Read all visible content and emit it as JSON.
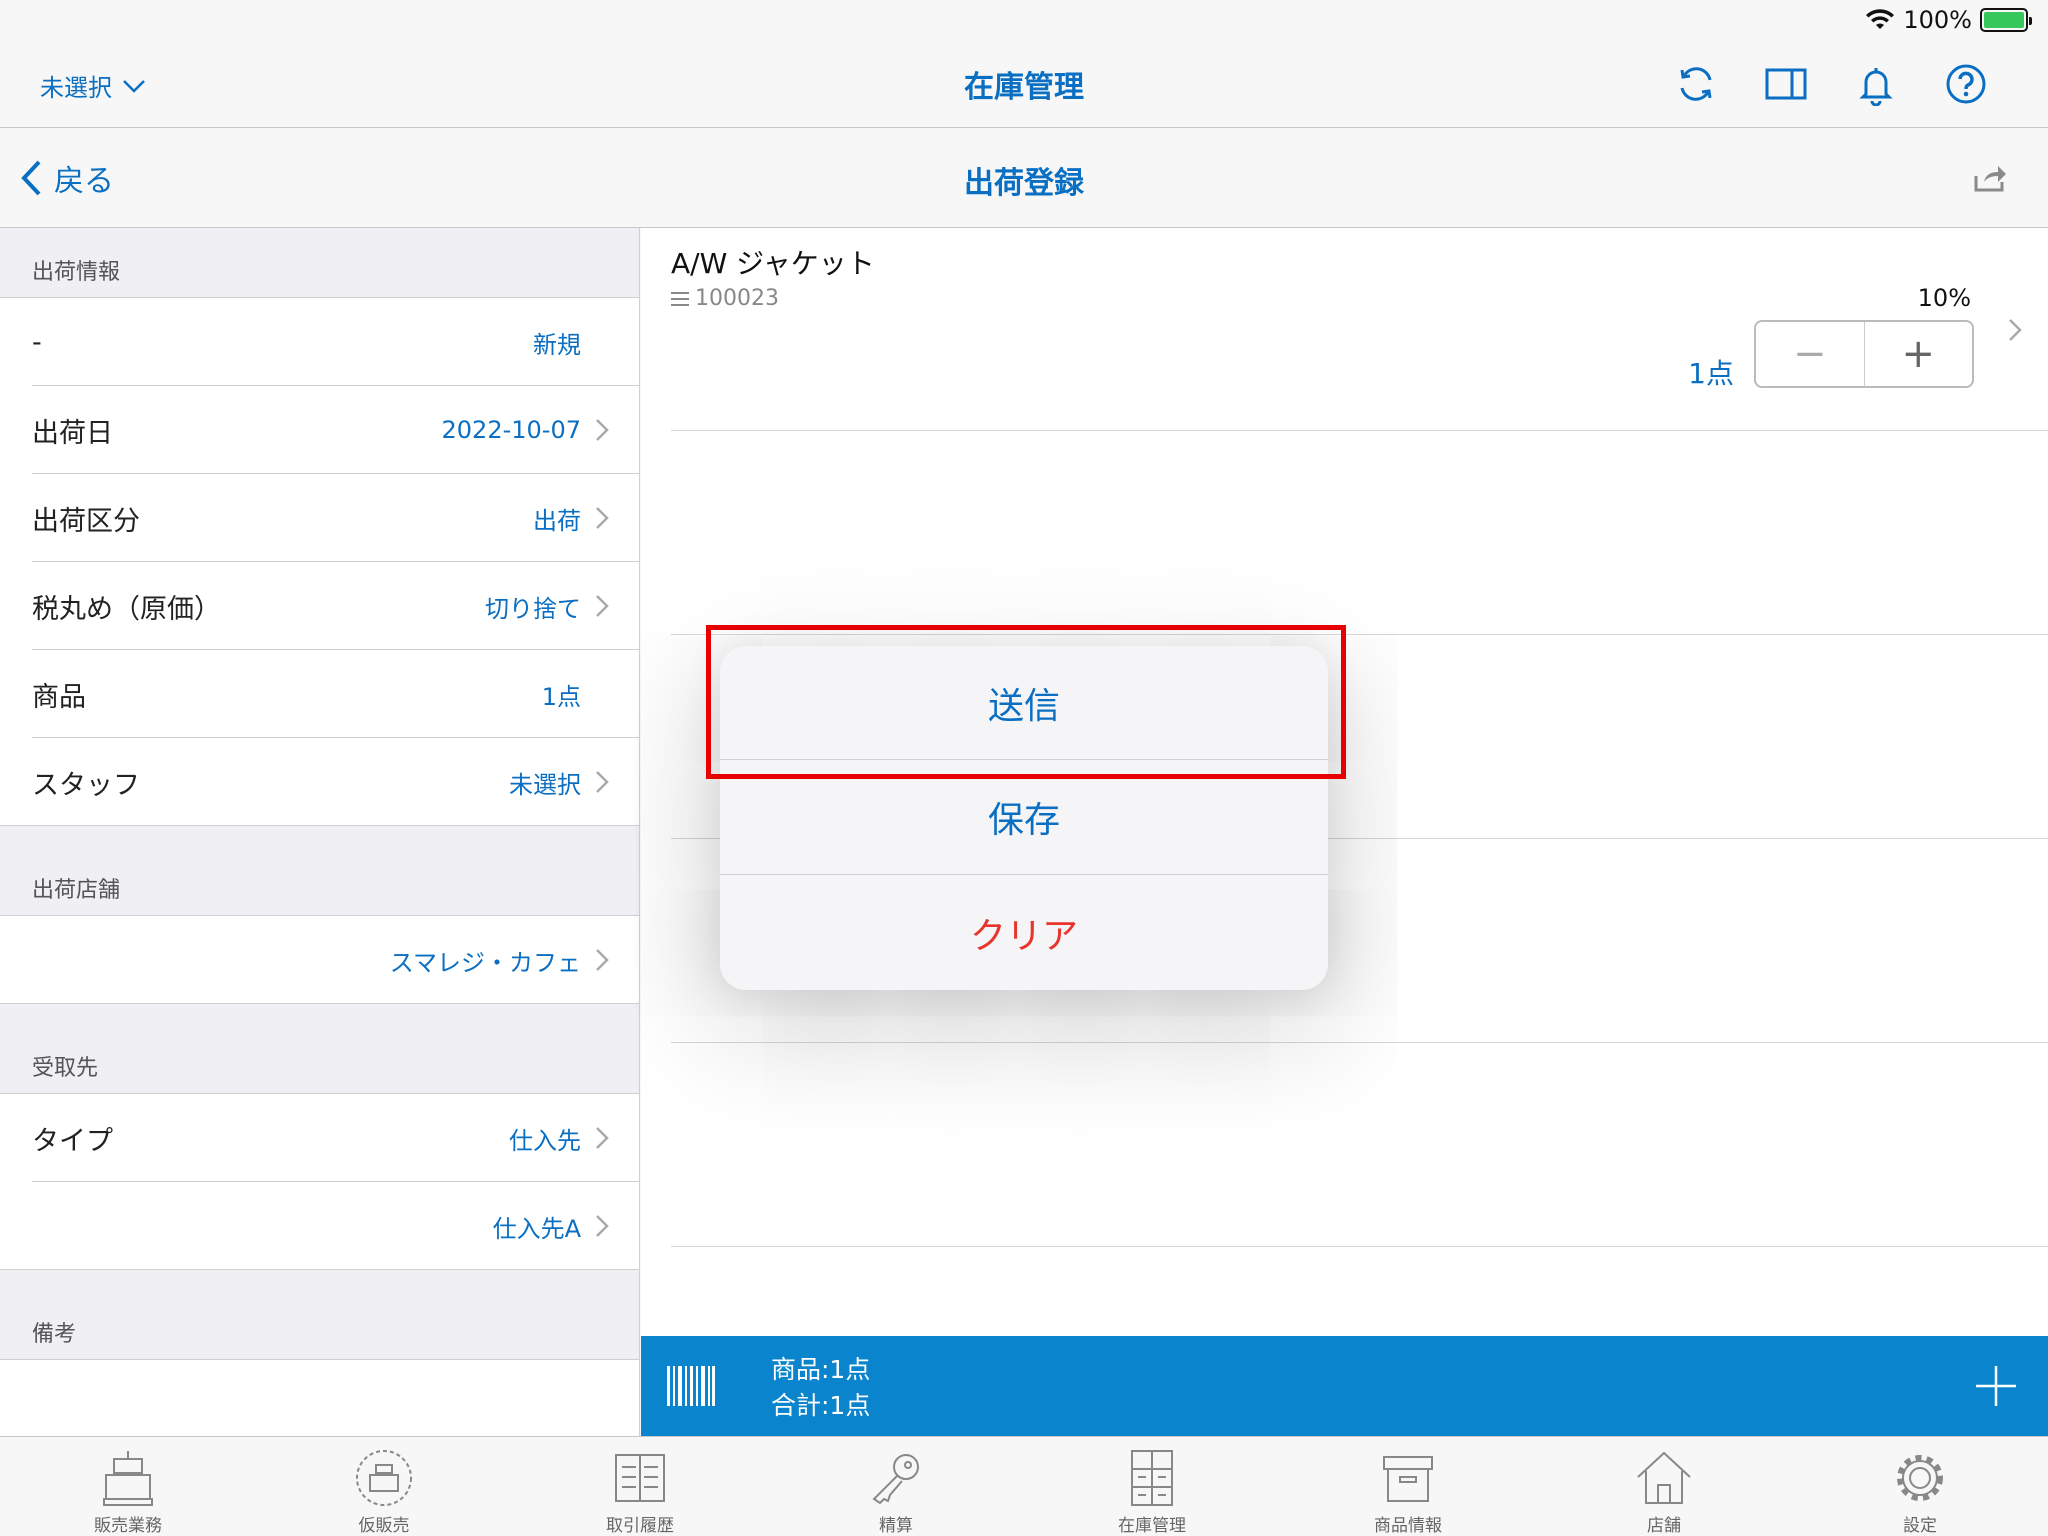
{
  "status": {
    "battery_text": "100%"
  },
  "topnav": {
    "store_select": "未選択",
    "title": "在庫管理"
  },
  "subnav": {
    "back_label": "戻る",
    "title": "出荷登録"
  },
  "sections": {
    "shipping_info": "出荷情報",
    "shipping_store": "出荷店舗",
    "recipient": "受取先",
    "remarks": "備考"
  },
  "rows": {
    "status": {
      "label": "-",
      "value": "新規"
    },
    "ship_date": {
      "label": "出荷日",
      "value": "2022-10-07"
    },
    "ship_type": {
      "label": "出荷区分",
      "value": "出荷"
    },
    "tax_rounding": {
      "label": "税丸め（原価）",
      "value": "切り捨て"
    },
    "products": {
      "label": "商品",
      "value": "1点"
    },
    "staff": {
      "label": "スタッフ",
      "value": "未選択"
    },
    "store": {
      "value": "スマレジ・カフェ"
    },
    "recipient_type": {
      "label": "タイプ",
      "value": "仕入先"
    },
    "recipient_name": {
      "value": "仕入先A"
    }
  },
  "product": {
    "name": "A/W ジャケット",
    "code": "100023",
    "tax": "10%",
    "qty": "1点",
    "minus": "−",
    "plus": "+"
  },
  "bottombar": {
    "items": "商品:1点",
    "total": "合計:1点"
  },
  "popup": {
    "send": "送信",
    "save": "保存",
    "clear": "クリア"
  },
  "tabs": [
    "販売業務",
    "仮販売",
    "取引履歴",
    "精算",
    "在庫管理",
    "商品情報",
    "店舗",
    "設定"
  ],
  "colors": {
    "accent": "#0a6fc2",
    "bar": "#0a84cc",
    "danger": "#e8352b",
    "highlight": "#e60000"
  }
}
